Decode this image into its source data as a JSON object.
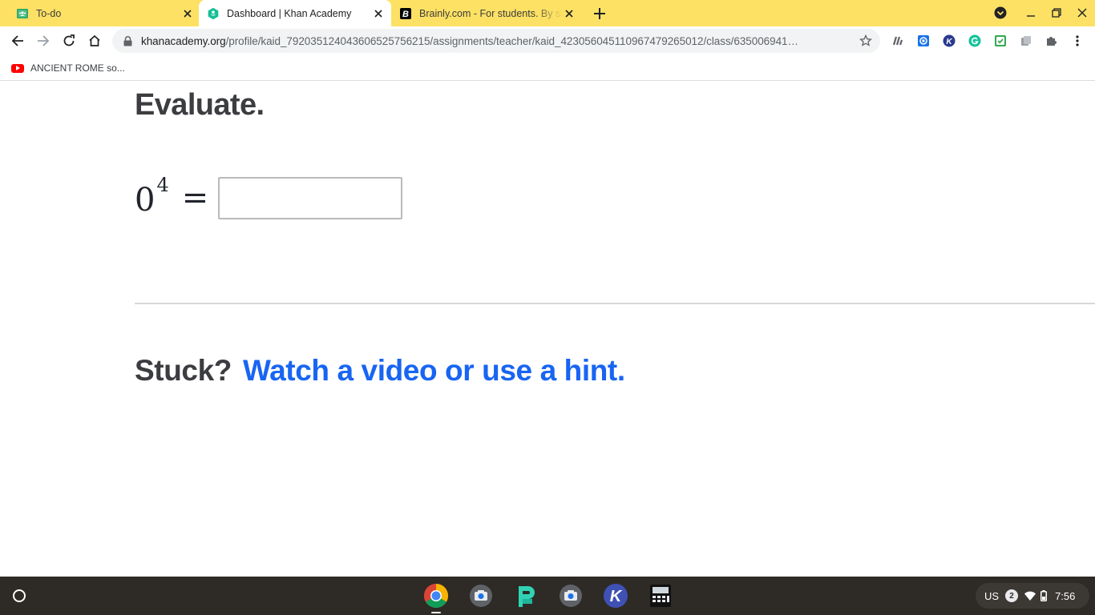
{
  "browser": {
    "tabs": [
      {
        "title": "To-do",
        "icon": "google-classroom-icon"
      },
      {
        "title": "Dashboard | Khan Academy",
        "icon": "khan-academy-icon"
      },
      {
        "title": "Brainly.com - For students. By students.",
        "icon": "brainly-icon"
      }
    ],
    "active_tab": 1,
    "url_host": "khanacademy.org",
    "url_path": "/profile/kaid_792035124043606525756215/assignments/teacher/kaid_423056045110967479265012/class/635006941…",
    "bookmark": {
      "label": "ANCIENT ROME so...",
      "icon": "youtube-icon"
    },
    "extensions": [
      "extension-generic-icon",
      "extension-blue-icon",
      "extension-k-icon",
      "grammarly-icon",
      "extension-green-icon",
      "extension-gray-icon",
      "puzzle-icon"
    ]
  },
  "page": {
    "heading": "Evaluate.",
    "equation": {
      "base": "0",
      "exponent": "4",
      "equals": "="
    },
    "answer_placeholder": "",
    "stuck_label": "Stuck?",
    "hint_link": "Watch a video or use a hint."
  },
  "shelf": {
    "apps": [
      "chrome-icon",
      "camera-icon",
      "pear-deck-icon",
      "camera-icon",
      "kami-icon",
      "calculator-icon"
    ],
    "tray": {
      "language": "US",
      "notifications": "2",
      "time": "7:56"
    }
  },
  "colors": {
    "tabstrip": "#fde164",
    "link": "#1865f2",
    "heading": "#3c3d40"
  }
}
